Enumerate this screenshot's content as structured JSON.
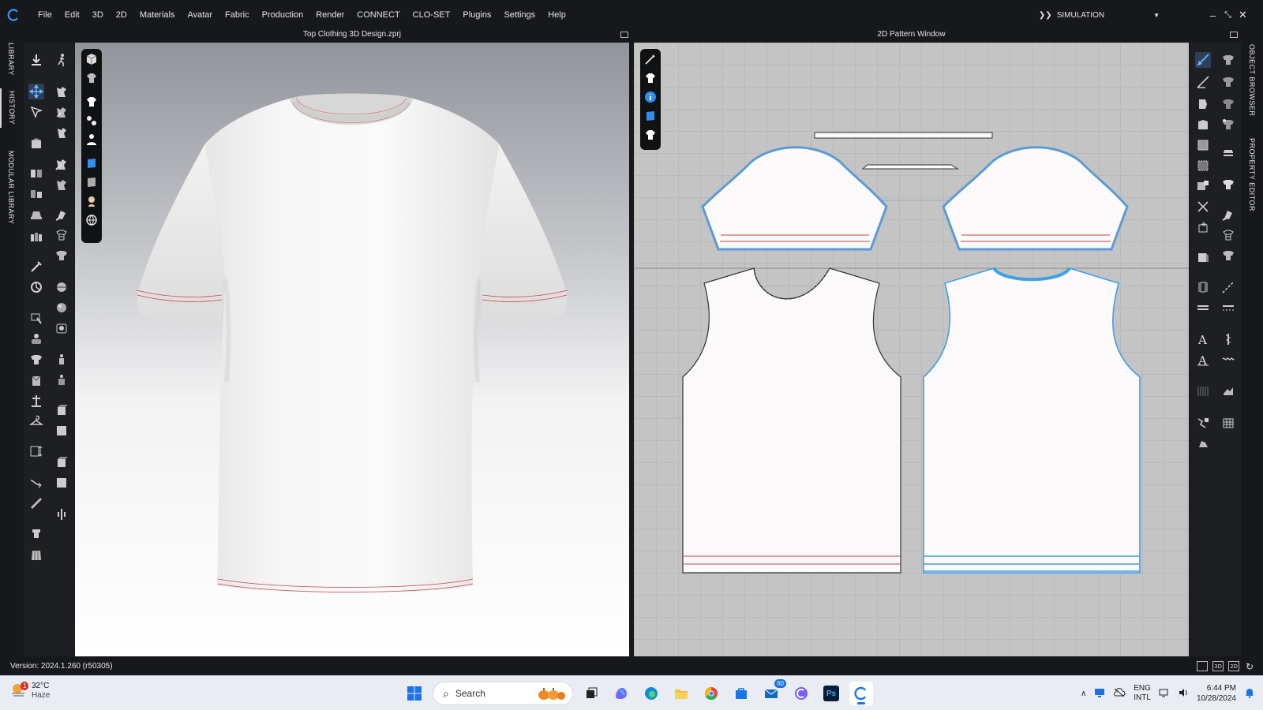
{
  "menubar": {
    "items": [
      "File",
      "Edit",
      "3D",
      "2D",
      "Materials",
      "Avatar",
      "Fabric",
      "Production",
      "Render",
      "CONNECT",
      "CLO-SET",
      "Plugins",
      "Settings",
      "Help"
    ],
    "mode": "SIMULATION"
  },
  "left_tabs": [
    "LIBRARY",
    "HISTORY",
    "MODULAR LIBRARY"
  ],
  "right_tabs": [
    "OBJECT BROWSER",
    "PROPERTY EDITOR"
  ],
  "viewport3d": {
    "title": "Top Clothing 3D Design.zprj"
  },
  "viewport2d": {
    "title": "2D Pattern Window"
  },
  "status": {
    "version": "Version: 2024.1.260 (r50305)",
    "view_buttons": [
      "3D",
      "2D"
    ]
  },
  "taskbar": {
    "weather_temp": "32°C",
    "weather_cond": "Haze",
    "weather_badge": "1",
    "search_placeholder": "Search",
    "mail_badge": "60",
    "ps_label": "Ps",
    "lang_1": "ENG",
    "lang_2": "INTL",
    "time": "6:44 PM",
    "date": "10/28/2024"
  },
  "colors": {
    "accent": "#1a73e8",
    "selection": "#3fa0e8",
    "seam_red": "#c94545"
  }
}
